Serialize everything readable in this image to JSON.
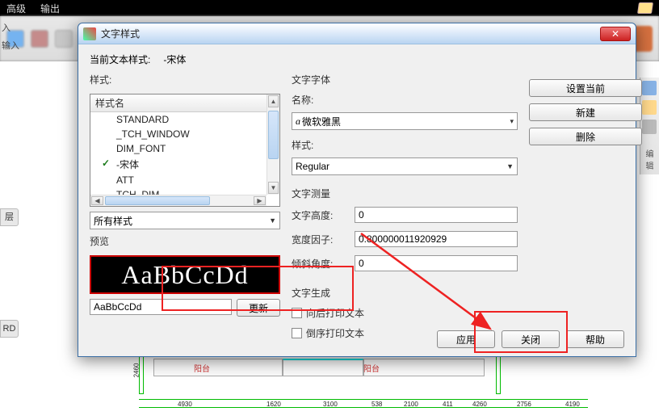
{
  "ribbon": {
    "tab1": "高级",
    "tab2": "输出"
  },
  "left_labels": {
    "l1": "入",
    "l2": "输入",
    "l3": "层",
    "l4": "RD"
  },
  "right_panel_label": "编辑",
  "dialog": {
    "title": "文字样式",
    "current_style_label": "当前文本样式:",
    "current_style_value": "-宋体",
    "styles_label": "样式:",
    "listbox_header": "样式名",
    "styles": [
      "STANDARD",
      "_TCH_WINDOW",
      "DIM_FONT",
      "-宋体",
      "ATT",
      "TCH_DIM"
    ],
    "checked_index": 3,
    "all_styles": "所有样式",
    "preview_label": "预览",
    "preview_text": "AaBbCcDd",
    "preview_input": "AaBbCcDd",
    "update_btn": "更新",
    "font_group": "文字字体",
    "font_name_label": "名称:",
    "font_name_value": "微软雅黑",
    "font_style_label": "样式:",
    "font_style_value": "Regular",
    "measure_group": "文字测量",
    "height_label": "文字高度:",
    "height_value": "0",
    "width_label": "宽度因子:",
    "width_value": "0.800000011920929",
    "oblique_label": "倾斜角度:",
    "oblique_value": "0",
    "gen_group": "文字生成",
    "backwards_label": "向后打印文本",
    "upsidedown_label": "倒序打印文本",
    "set_current_btn": "设置当前",
    "new_btn": "新建",
    "delete_btn": "删除",
    "apply_btn": "应用",
    "close_btn": "关闭",
    "help_btn": "帮助"
  },
  "drawing": {
    "label1": "阳台",
    "label2": "阳台",
    "dim1": "2460",
    "dim2": "4930",
    "dim3": "1620",
    "dim4": "3100",
    "dim5": "538",
    "dim6": "2100",
    "dim7": "411",
    "dim8": "4260",
    "dim9": "2756",
    "dim10": "4190"
  }
}
